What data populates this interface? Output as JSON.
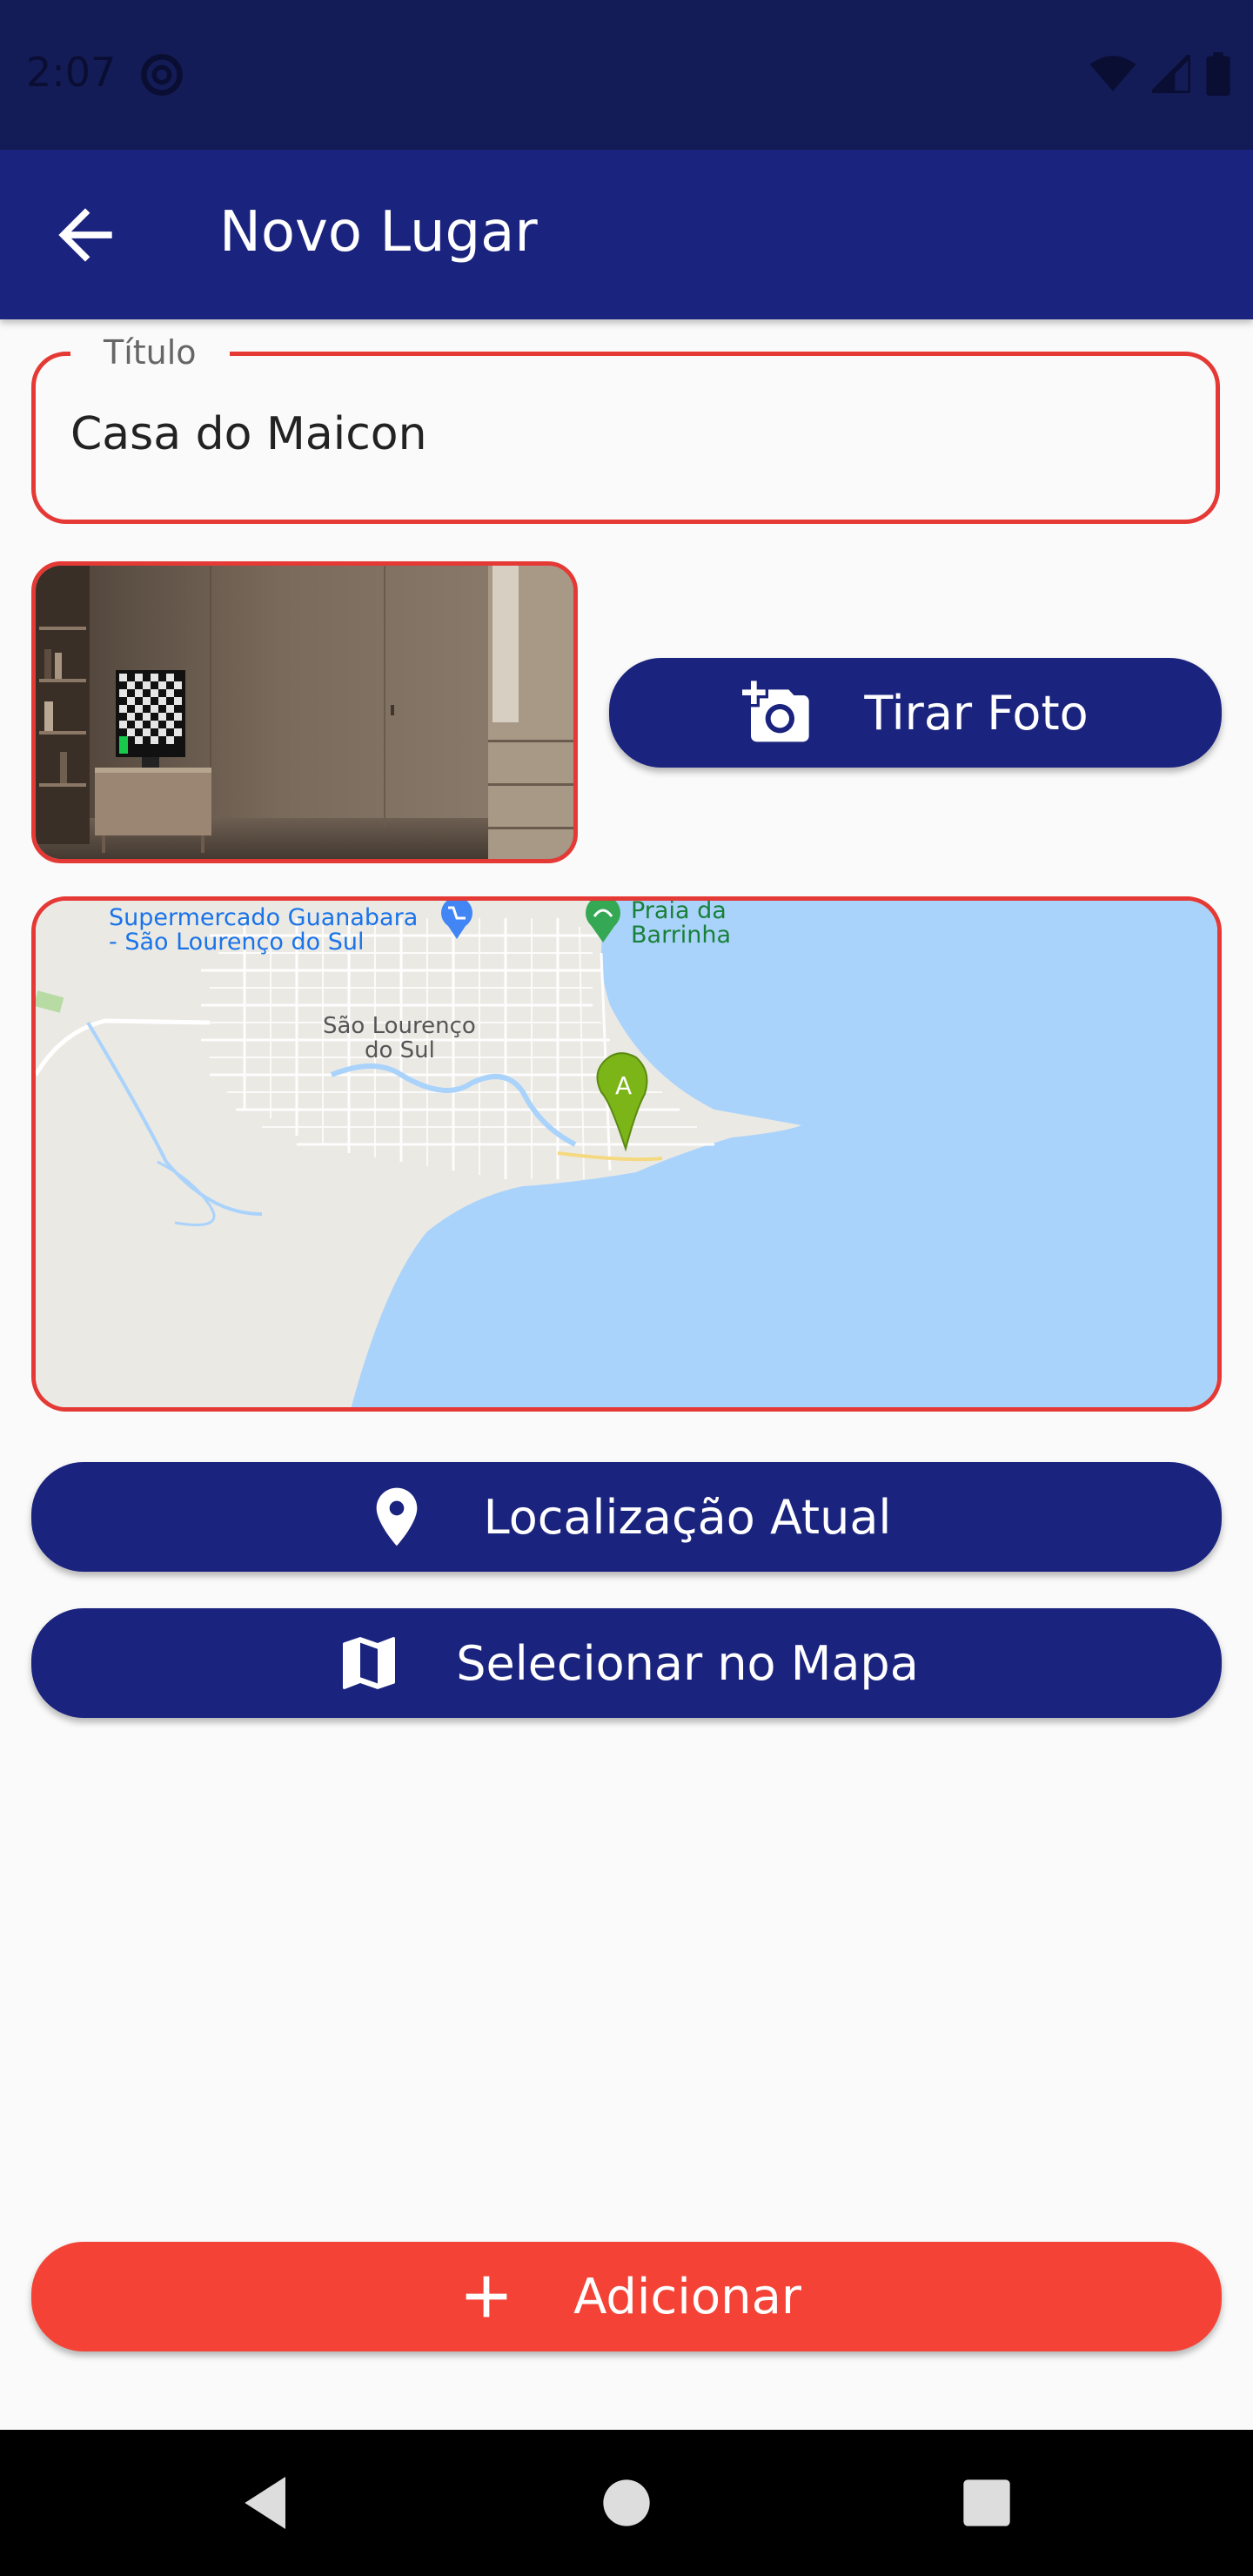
{
  "status_bar": {
    "time": "2:07"
  },
  "app_bar": {
    "title": "Novo Lugar"
  },
  "title_field": {
    "label": "Título",
    "value": "Casa do Maicon"
  },
  "photo_button": {
    "label": "Tirar Foto",
    "icon": "add-a-photo-icon"
  },
  "map": {
    "labels": {
      "supermarket_line1": "Supermercado Guanabara",
      "supermarket_line2": "- São Lourenço do Sul",
      "beach_line1": "Praia da",
      "beach_line2": "Barrinha",
      "city_line1": "São Lourenço",
      "city_line2": "do Sul",
      "marker": "A"
    },
    "colors": {
      "water": "#aad3fb",
      "land": "#ebe9e4",
      "marker": "#7cb518"
    }
  },
  "location_button": {
    "label": "Localização Atual",
    "icon": "location-pin-icon"
  },
  "map_button": {
    "label": "Selecionar no Mapa",
    "icon": "map-icon"
  },
  "add_button": {
    "label": "Adicionar",
    "icon": "plus-icon"
  },
  "colors": {
    "primary": "#1a237e",
    "accent": "#f44336",
    "error_border": "#e53935"
  }
}
